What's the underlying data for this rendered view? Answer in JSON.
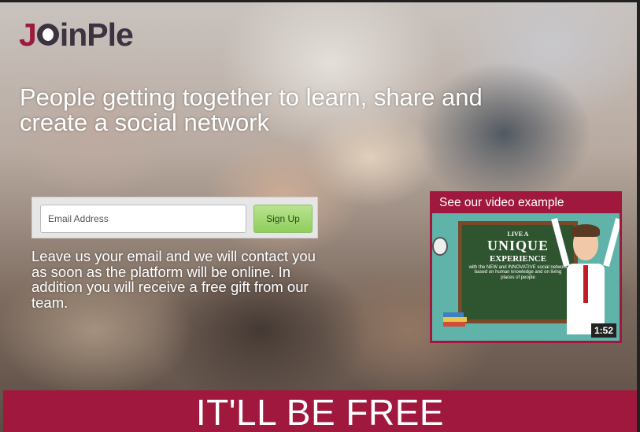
{
  "brand": {
    "logo_text_j": "J",
    "logo_text_rest": "inPle",
    "logo_alt": "JoinPle",
    "accent_color": "#a0183e"
  },
  "hero": {
    "headline": "People getting together to learn, share and create a social network"
  },
  "signup": {
    "email_placeholder": "Email Address",
    "email_value": "",
    "button_label": "Sign Up",
    "info_text": "Leave us your email and we will contact you as soon as the platform will be online. In addition you will receive a free gift from our team."
  },
  "video": {
    "label": "See our video example",
    "thumb_line1": "LIVE A",
    "thumb_line2": "UNIQUE",
    "thumb_line3": "EXPERIENCE",
    "thumb_line4": "with the NEW and INNOVATIVE social network based on human knowledge and on living places of people",
    "duration": "1:52"
  },
  "banner": {
    "text": "IT'LL BE FREE"
  }
}
